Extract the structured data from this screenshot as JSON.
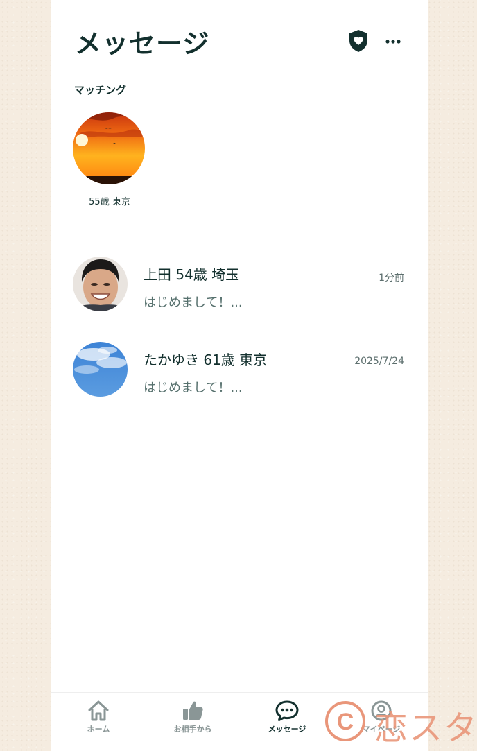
{
  "header": {
    "title": "メッセージ",
    "icons": [
      "shield-heart-icon",
      "more-icon"
    ]
  },
  "matching": {
    "label": "マッチング",
    "items": [
      {
        "caption": "55歳 東京",
        "avatar": "sunset-photo"
      }
    ]
  },
  "messages": [
    {
      "name": "上田 54歳 埼玉",
      "time": "1分前",
      "preview": "はじめまして！...",
      "avatar": "man-photo"
    },
    {
      "name": "たかゆき 61歳 東京",
      "time": "2025/7/24",
      "preview": "はじめまして！...",
      "avatar": "sky-photo"
    }
  ],
  "tabbar": {
    "items": [
      {
        "label": "ホーム",
        "icon": "home-icon",
        "active": false
      },
      {
        "label": "お相手から",
        "icon": "thumbs-up-icon",
        "active": false
      },
      {
        "label": "メッセージ",
        "icon": "chat-bubble-icon",
        "active": true
      },
      {
        "label": "マイページ",
        "icon": "profile-icon",
        "active": false
      }
    ]
  },
  "watermark": {
    "text": "恋スタ",
    "symbol": "C",
    "color": "#e9967a"
  },
  "colors": {
    "primary_text": "#13302e",
    "muted_text": "#56706d",
    "inactive_tab": "#8a9696",
    "background": "#f5ece0"
  }
}
